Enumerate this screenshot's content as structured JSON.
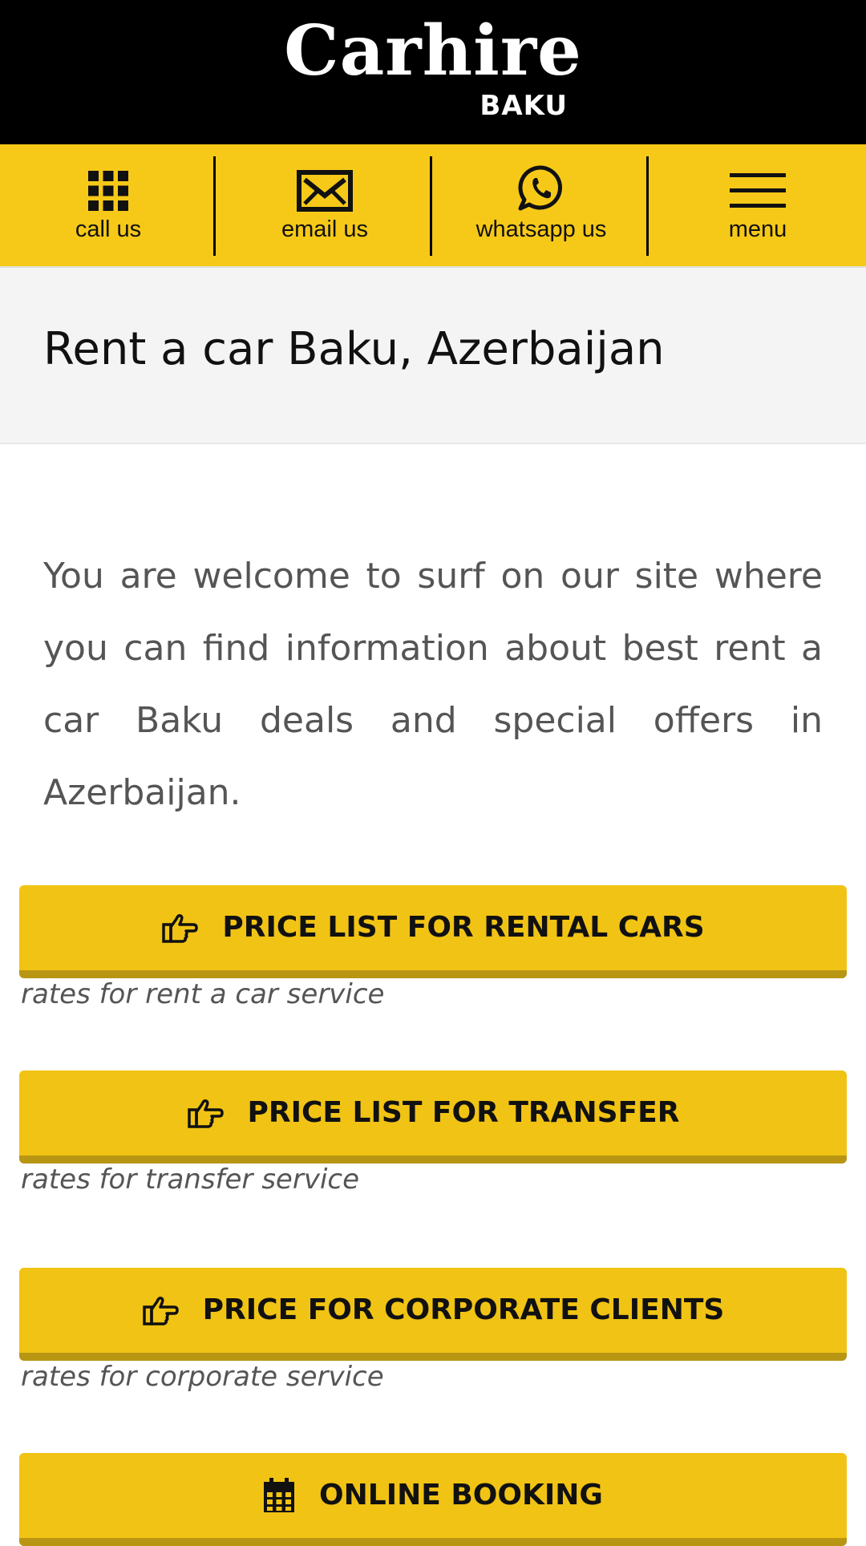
{
  "brand": {
    "name": "Carhire",
    "subname": "BAKU"
  },
  "contact_bar": {
    "items": [
      {
        "label": "call us",
        "icon": "dialpad-icon"
      },
      {
        "label": "email us",
        "icon": "envelope-icon"
      },
      {
        "label": "whatsapp us",
        "icon": "whatsapp-icon"
      },
      {
        "label": "menu",
        "icon": "hamburger-icon"
      }
    ]
  },
  "page": {
    "title": "Rent a car Baku, Azerbaijan",
    "intro": "You are welcome to surf on our site where you can find information about best rent a car Baku deals and special offers in Azerbaijan."
  },
  "actions": [
    {
      "label": "PRICE LIST FOR RENTAL CARS",
      "caption": "rates for rent a car service",
      "icon": "hand-pointing-right-icon"
    },
    {
      "label": "PRICE LIST FOR TRANSFER",
      "caption": "rates for transfer service",
      "icon": "hand-pointing-right-icon"
    },
    {
      "label": "PRICE FOR CORPORATE CLIENTS",
      "caption": "rates for corporate service",
      "icon": "hand-pointing-right-icon"
    },
    {
      "label": "ONLINE BOOKING",
      "caption": "",
      "icon": "calendar-icon"
    }
  ],
  "colors": {
    "header_bg": "#000000",
    "contact_bar_bg": "#f6c918",
    "button_bg": "#f1c314",
    "button_shadow": "#b89614",
    "title_band_bg": "#f4f4f4",
    "body_text": "#555555"
  }
}
